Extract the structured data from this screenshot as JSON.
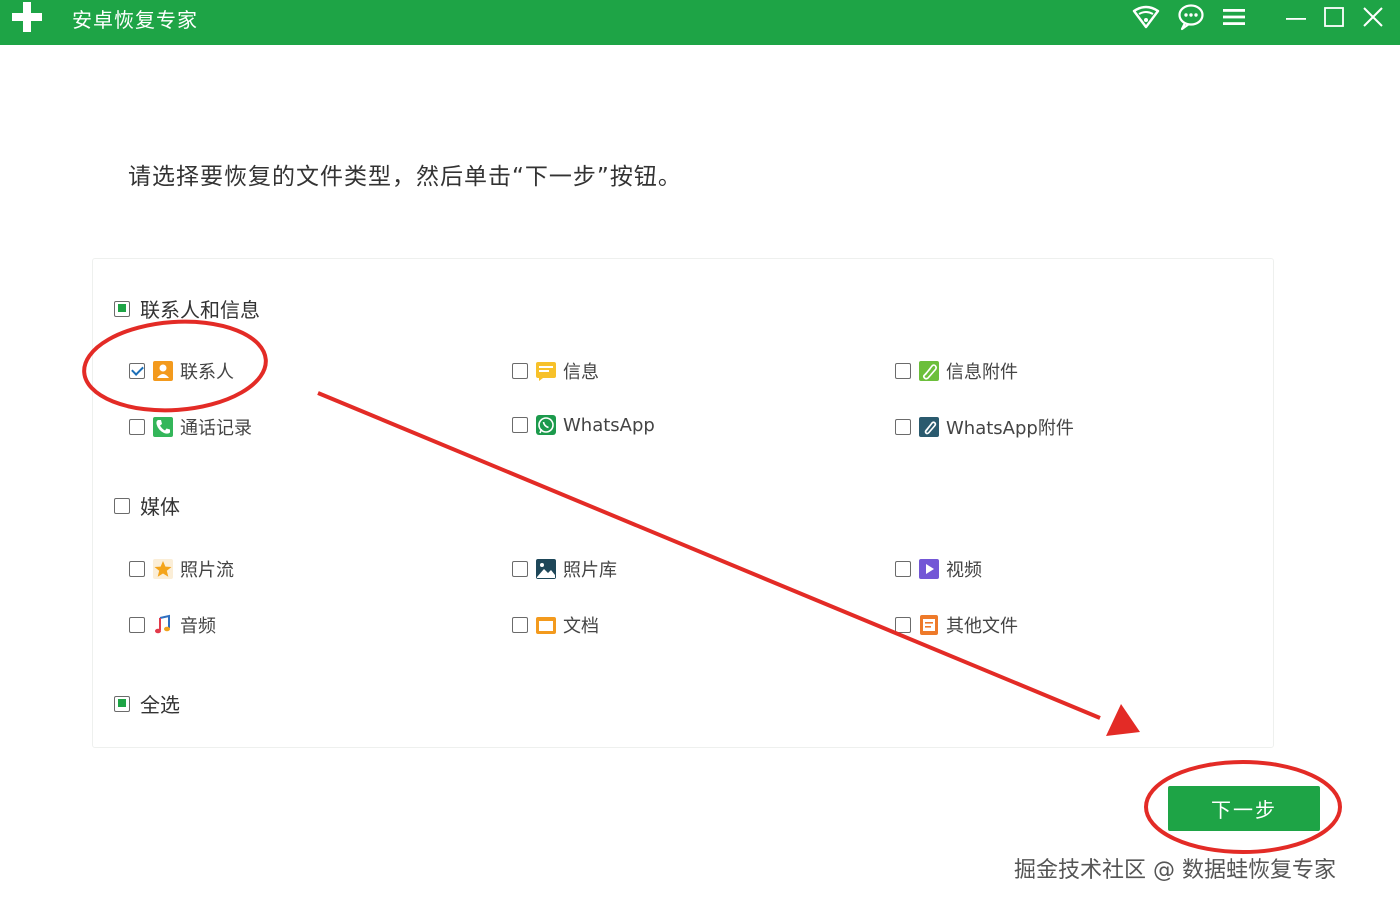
{
  "window": {
    "title": "安卓恢复专家"
  },
  "instruction": "请选择要恢复的文件类型，然后单击“下一步”按钮。",
  "sections": {
    "contacts_messages": {
      "label": "联系人和信息",
      "state": "partial",
      "items": {
        "contacts": {
          "label": "联系人",
          "checked": true
        },
        "messages": {
          "label": "信息",
          "checked": false
        },
        "message_attachments": {
          "label": "信息附件",
          "checked": false
        },
        "call_log": {
          "label": "通话记录",
          "checked": false
        },
        "whatsapp": {
          "label": "WhatsApp",
          "checked": false
        },
        "whatsapp_attachments": {
          "label": "WhatsApp附件",
          "checked": false
        }
      }
    },
    "media": {
      "label": "媒体",
      "state": "unchecked",
      "items": {
        "photo_stream": {
          "label": "照片流",
          "checked": false
        },
        "photo_library": {
          "label": "照片库",
          "checked": false
        },
        "video": {
          "label": "视频",
          "checked": false
        },
        "audio": {
          "label": "音频",
          "checked": false
        },
        "documents": {
          "label": "文档",
          "checked": false
        },
        "other_files": {
          "label": "其他文件",
          "checked": false
        }
      }
    },
    "select_all": {
      "label": "全选",
      "state": "partial"
    }
  },
  "buttons": {
    "next": "下一步"
  },
  "watermark": "掘金技术社区 @ 数据蛙恢复专家",
  "colors": {
    "brand_green": "#1ea446",
    "annotation_red": "#e32b26"
  }
}
